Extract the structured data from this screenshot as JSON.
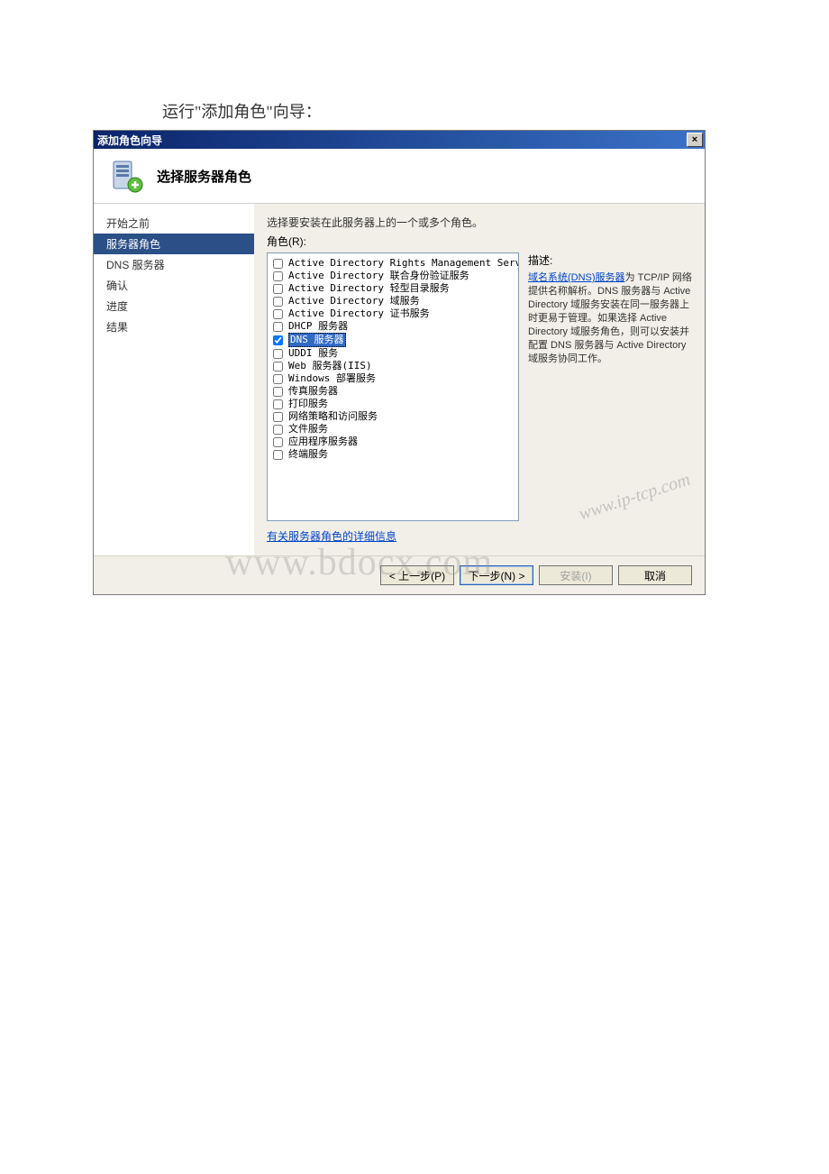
{
  "page_caption": "运行\"添加角色\"向导：",
  "dialog": {
    "title": "添加角色向导",
    "close_glyph": "×",
    "header_title": "选择服务器角色"
  },
  "sidebar": {
    "items": [
      {
        "label": "开始之前"
      },
      {
        "label": "服务器角色",
        "selected": true
      },
      {
        "label": "DNS 服务器"
      },
      {
        "label": "确认"
      },
      {
        "label": "进度"
      },
      {
        "label": "结果"
      }
    ]
  },
  "main": {
    "instruction": "选择要安装在此服务器上的一个或多个角色。",
    "roles_label": "角色(R):",
    "roles": [
      {
        "label": "Active Directory Rights Management Services",
        "checked": false
      },
      {
        "label": "Active Directory 联合身份验证服务",
        "checked": false
      },
      {
        "label": "Active Directory 轻型目录服务",
        "checked": false
      },
      {
        "label": "Active Directory 域服务",
        "checked": false
      },
      {
        "label": "Active Directory 证书服务",
        "checked": false
      },
      {
        "label": "DHCP 服务器",
        "checked": false
      },
      {
        "label": "DNS 服务器",
        "checked": true,
        "selected": true
      },
      {
        "label": "UDDI 服务",
        "checked": false
      },
      {
        "label": "Web 服务器(IIS)",
        "checked": false
      },
      {
        "label": "Windows 部署服务",
        "checked": false
      },
      {
        "label": "传真服务器",
        "checked": false
      },
      {
        "label": "打印服务",
        "checked": false
      },
      {
        "label": "网络策略和访问服务",
        "checked": false
      },
      {
        "label": "文件服务",
        "checked": false
      },
      {
        "label": "应用程序服务器",
        "checked": false
      },
      {
        "label": "终端服务",
        "checked": false
      }
    ],
    "desc_title": "描述:",
    "desc_link": "域名系统(DNS)服务器",
    "desc_rest": "为 TCP/IP 网络提供名称解析。DNS 服务器与 Active Directory 域服务安装在同一服务器上时更易于管理。如果选择 Active Directory 域服务角色，则可以安装并配置 DNS 服务器与 Active Directory 域服务协同工作。",
    "more_info": "有关服务器角色的详细信息"
  },
  "footer": {
    "back": "< 上一步(P)",
    "next": "下一步(N) >",
    "install": "安装(I)",
    "cancel": "取消"
  },
  "watermarks": {
    "w1": "www.bdocx.com",
    "w2": "www.ip-tcp.com"
  }
}
